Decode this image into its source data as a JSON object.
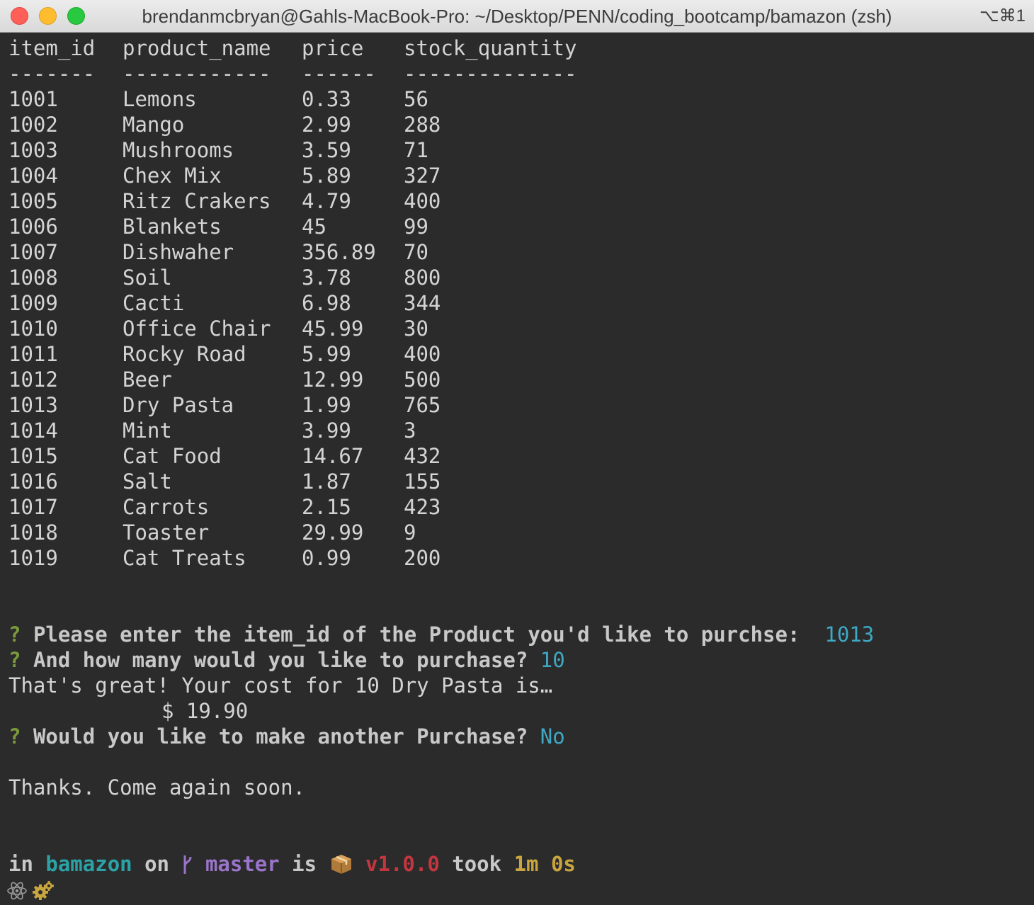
{
  "window": {
    "title": "brendanmcbryan@Gahls-MacBook-Pro: ~/Desktop/PENN/coding_bootcamp/bamazon (zsh)",
    "shortcut": "⌥⌘1"
  },
  "table": {
    "headers": [
      "item_id",
      "product_name",
      "price",
      "stock_quantity"
    ],
    "separators": [
      "-------",
      "------------",
      "------",
      "--------------"
    ],
    "rows": [
      [
        "1001",
        "Lemons",
        "0.33",
        "56"
      ],
      [
        "1002",
        "Mango",
        "2.99",
        "288"
      ],
      [
        "1003",
        "Mushrooms",
        "3.59",
        "71"
      ],
      [
        "1004",
        "Chex Mix",
        "5.89",
        "327"
      ],
      [
        "1005",
        "Ritz Crakers",
        "4.79",
        "400"
      ],
      [
        "1006",
        "Blankets",
        "45",
        "99"
      ],
      [
        "1007",
        "Dishwaher",
        "356.89",
        "70"
      ],
      [
        "1008",
        "Soil",
        "3.78",
        "800"
      ],
      [
        "1009",
        "Cacti",
        "6.98",
        "344"
      ],
      [
        "1010",
        "Office Chair",
        "45.99",
        "30"
      ],
      [
        "1011",
        "Rocky Road",
        "5.99",
        "400"
      ],
      [
        "1012",
        "Beer",
        "12.99",
        "500"
      ],
      [
        "1013",
        "Dry Pasta",
        "1.99",
        "765"
      ],
      [
        "1014",
        "Mint",
        "3.99",
        "3"
      ],
      [
        "1015",
        "Cat Food",
        "14.67",
        "432"
      ],
      [
        "1016",
        "Salt",
        "1.87",
        "155"
      ],
      [
        "1017",
        "Carrots",
        "2.15",
        "423"
      ],
      [
        "1018",
        "Toaster",
        "29.99",
        "9"
      ],
      [
        "1019",
        "Cat Treats",
        "0.99",
        "200"
      ]
    ]
  },
  "prompts": {
    "marker": "?",
    "q1": "Please enter the item_id of the Product you'd like to purchse:",
    "a1": "1013",
    "q2": "And how many would you like to purchase?",
    "a2": "10",
    "cost_line": "That's great! Your cost for 10 Dry Pasta is…",
    "cost_value": "$ 19.90",
    "q3": "Would you like to make another Purchase?",
    "a3": "No",
    "goodbye": "Thanks. Come again soon."
  },
  "status": {
    "in": "in",
    "repo": "bamazon",
    "on": "on",
    "branch_icon": "",
    "branch": "master",
    "is": "is",
    "package_icon": "📦",
    "version": "v1.0.0",
    "took": "took",
    "duration": "1m 0s"
  },
  "icons": {
    "bottom": [
      "atom-icon",
      "gear-icon"
    ],
    "colors": {
      "gear": "#c9a53f",
      "atom": "#9a9a9a"
    }
  }
}
